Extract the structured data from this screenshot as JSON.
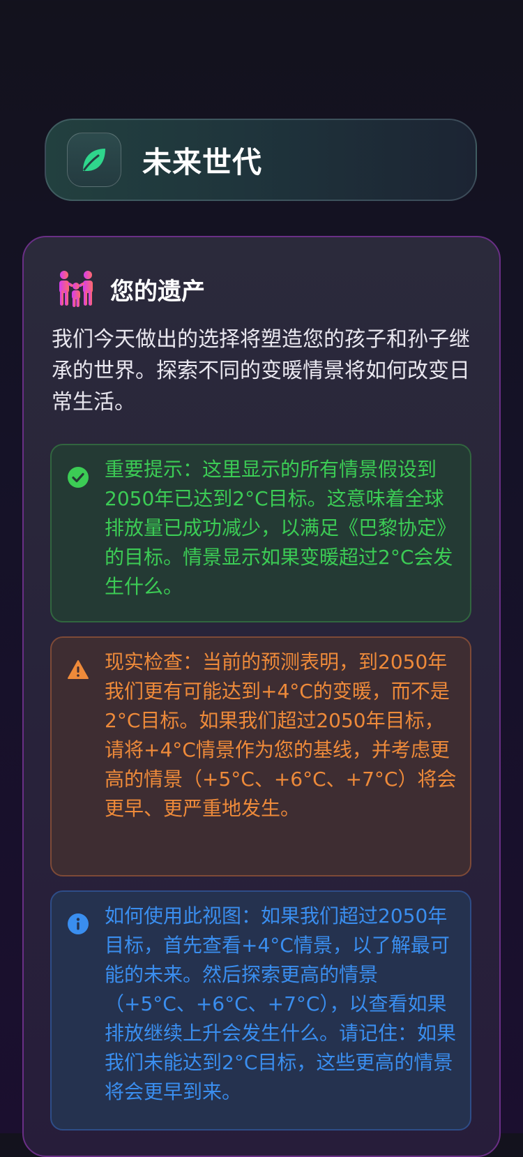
{
  "header": {
    "title": "未来世代",
    "icon": "leaf-icon",
    "accent": "#2fd68c"
  },
  "legacy": {
    "icon": "family-icon",
    "title": "您的遗产",
    "intro": "我们今天做出的选择将塑造您的孩子和孙子继承的世界。探索不同的变暖情景将如何改变日常生活。",
    "notes": [
      {
        "type": "success",
        "icon": "check-circle-icon",
        "color": "#3ccc55",
        "text": "重要提示：这里显示的所有情景假设到2050年已达到2°C目标。这意味着全球排放量已成功减少，以满足《巴黎协定》的目标。情景显示如果变暖超过2°C会发生什么。"
      },
      {
        "type": "warning",
        "icon": "warning-icon",
        "color": "#ee8a3a",
        "text": "现实检查：当前的预测表明，到2050年我们更有可能达到+4°C的变暖，而不是2°C目标。如果我们超过2050年目标，请将+4°C情景作为您的基线，并考虑更高的情景（+5°C、+6°C、+7°C）将会更早、更严重地发生。"
      },
      {
        "type": "info",
        "icon": "info-icon",
        "color": "#3a8eef",
        "text": "如何使用此视图：如果我们超过2050年目标，首先查看+4°C情景，以了解最可能的未来。然后探索更高的情景（+5°C、+6°C、+7°C），以查看如果排放继续上升会发生什么。请记住：如果我们未能达到2°C目标，这些更高的情景将会更早到来。"
      }
    ]
  }
}
